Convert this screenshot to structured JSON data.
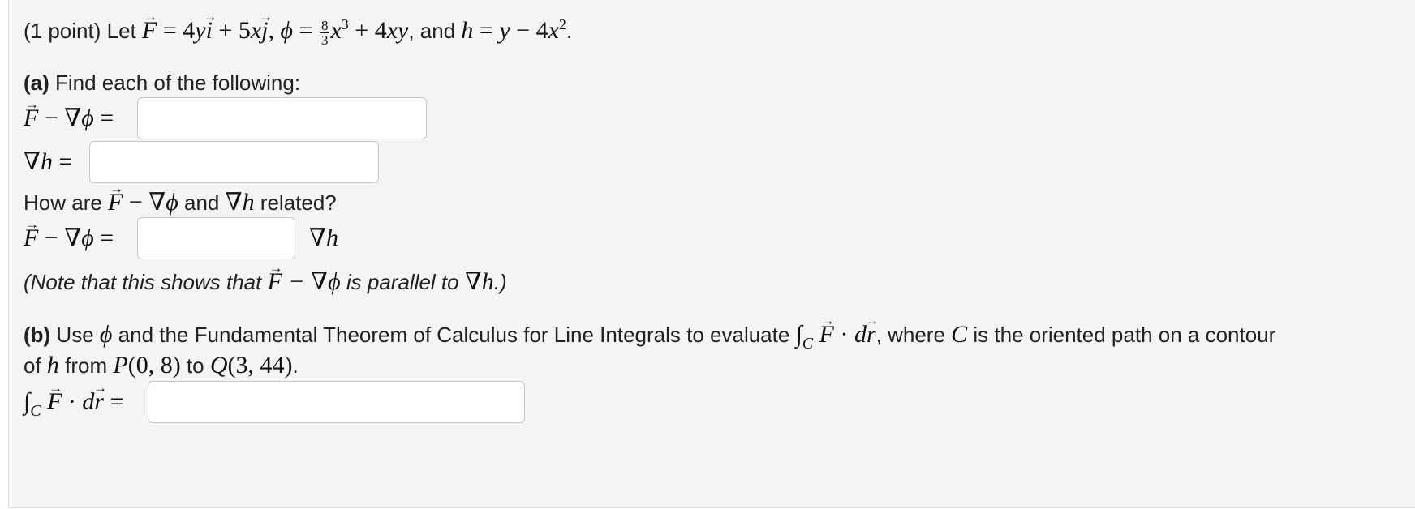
{
  "problem": {
    "prefix": "(1 point) Let ",
    "def_F": " = 4yi + 5xj, ",
    "phi": "ϕ",
    "def_phi_eq": " = ",
    "frac_num": "8",
    "frac_den": "3",
    "def_phi_rest": "x³ + 4xy",
    "and_text": ", and ",
    "def_h": "h = y − 4x²",
    "end": "."
  },
  "part_a": {
    "label": "(a)",
    "instruction": " Find each of the following:",
    "q1_lhs": "F − ∇ϕ =",
    "q2_lhs": "∇h =",
    "relation_prefix": "How are ",
    "relation_mid": "F − ∇ϕ",
    "relation_and": " and ",
    "relation_grad_h": "∇h",
    "relation_suffix": " related?",
    "q3_lhs": "F − ∇ϕ =",
    "q3_rhs": "∇h",
    "note_prefix": "(Note that this shows that ",
    "note_expr": "F − ∇ϕ",
    "note_mid": " is parallel to ",
    "note_grad_h": "∇h",
    "note_suffix": ".)"
  },
  "part_b": {
    "label": "(b)",
    "text1": " Use ",
    "text2": " and the Fundamental Theorem of Calculus for Line Integrals to evaluate ",
    "integral": "∫",
    "sub_C": "C",
    "dot_dr": " · d",
    "text3": ", where ",
    "C": "C",
    "text4": " is the oriented path on a contour",
    "text5": "of ",
    "h": "h",
    "text6": " from ",
    "P": "P(0, 8)",
    "text7": " to ",
    "Q": "Q(3, 44)",
    "text8": ".",
    "answer_lhs_eq": " ="
  },
  "answers": {
    "a1": "",
    "a2": "",
    "a3": "",
    "b1": ""
  }
}
